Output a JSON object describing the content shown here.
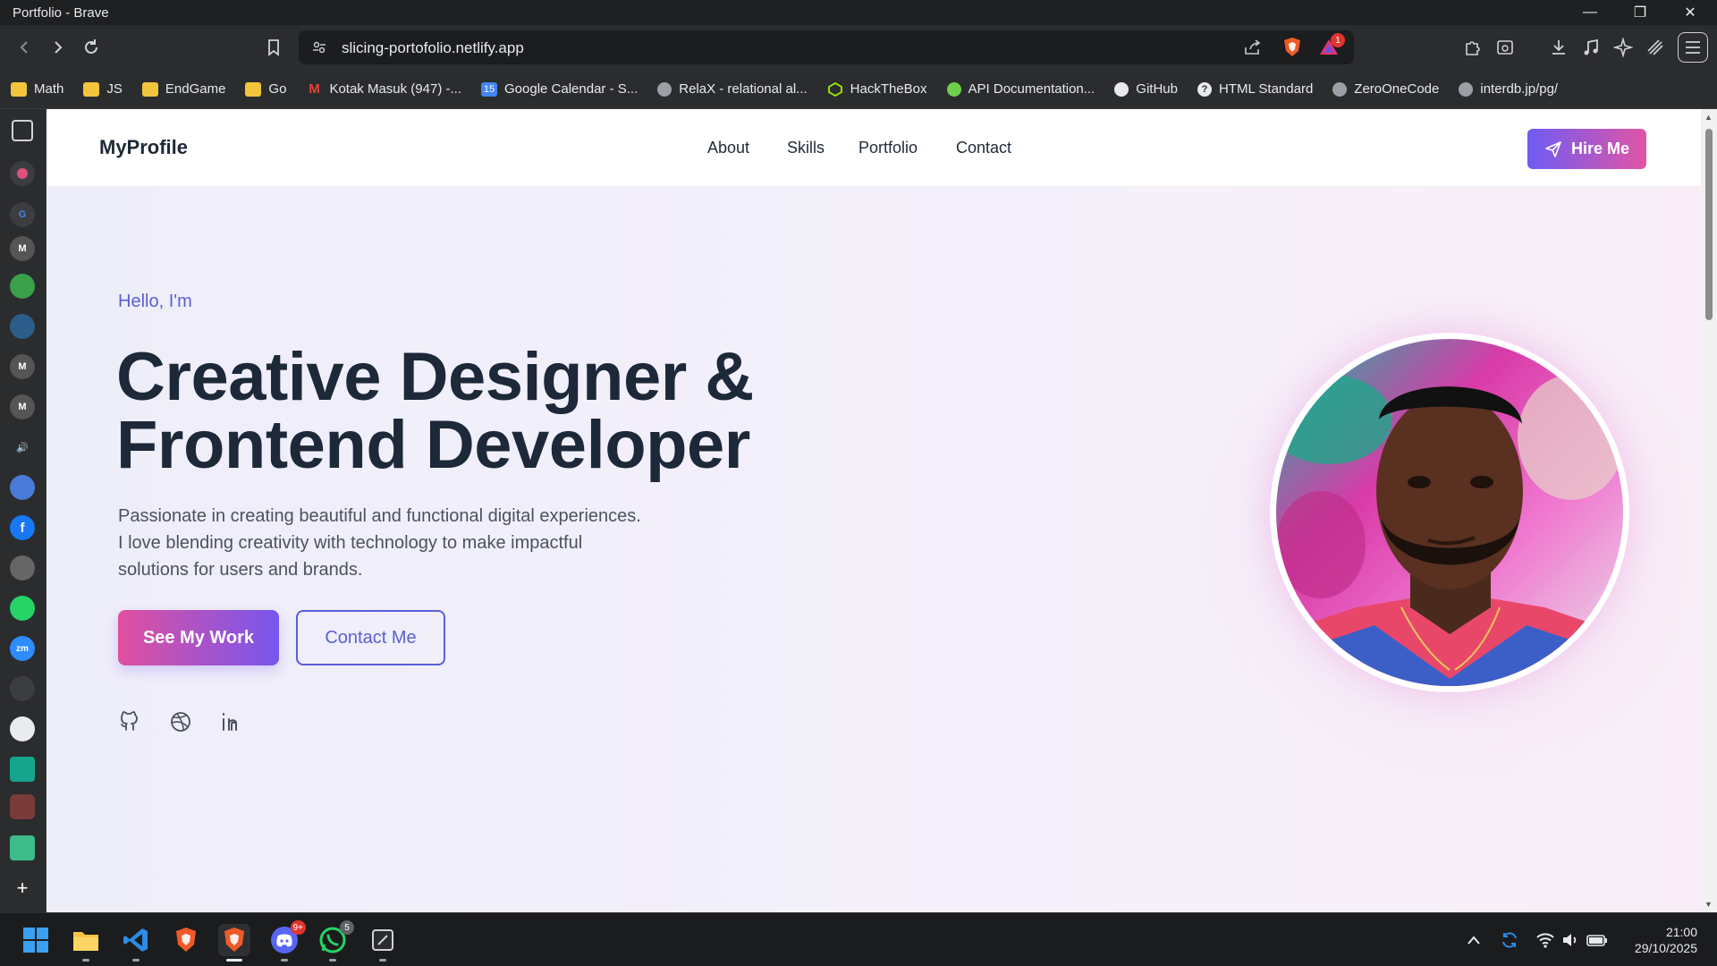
{
  "window": {
    "title": "Portfolio - Brave"
  },
  "toolbar": {
    "url": "slicing-portofolio.netlify.app",
    "alerts_count": "1"
  },
  "bookmarks": [
    {
      "label": "Math",
      "icon": "folder-icon"
    },
    {
      "label": "JS",
      "icon": "folder-icon"
    },
    {
      "label": "EndGame",
      "icon": "folder-icon"
    },
    {
      "label": "Go",
      "icon": "folder-icon"
    },
    {
      "label": "Kotak Masuk (947) -...",
      "icon": "gmail-icon"
    },
    {
      "label": "Google Calendar - S...",
      "icon": "calendar-icon"
    },
    {
      "label": "RelaX - relational al...",
      "icon": "globe-icon"
    },
    {
      "label": "HackTheBox",
      "icon": "hackthebox-icon"
    },
    {
      "label": "API Documentation...",
      "icon": "api-icon"
    },
    {
      "label": "GitHub",
      "icon": "github-icon"
    },
    {
      "label": "HTML Standard",
      "icon": "html-icon"
    },
    {
      "label": "ZeroOneCode",
      "icon": "globe-icon"
    },
    {
      "label": "interdb.jp/pg/",
      "icon": "globe-icon"
    }
  ],
  "site": {
    "logo": "MyProfile",
    "nav": [
      "About",
      "Skills",
      "Portfolio",
      "Contact"
    ],
    "hire_label": "Hire Me",
    "hello": "Hello, I'm",
    "headline_1": "Creative Designer &",
    "headline_2": "Frontend Developer",
    "description": "Passionate in creating beautiful and functional digital experiences. I love blending creativity with technology to make impactful solutions for users and brands.",
    "primary_cta": "See My Work",
    "secondary_cta": "Contact Me",
    "socials": [
      "github-icon",
      "dribbble-icon",
      "linkedin-icon"
    ]
  },
  "taskbar": {
    "discord_badge": "9+",
    "whatsapp_badge": "5",
    "time": "21:00",
    "date": "29/10/2025"
  },
  "colors": {
    "accent_purple": "#6d5cf3",
    "accent_pink": "#e254a5",
    "text_dark": "#1d2838",
    "link_purple": "#5a5fd6"
  }
}
